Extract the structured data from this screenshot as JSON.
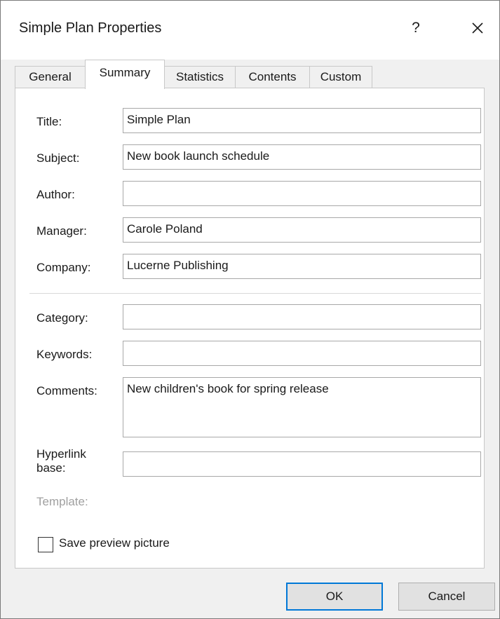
{
  "window": {
    "title": "Simple Plan Properties",
    "help_label": "?"
  },
  "tabs": [
    {
      "label": "General",
      "active": false
    },
    {
      "label": "Summary",
      "active": true
    },
    {
      "label": "Statistics",
      "active": false
    },
    {
      "label": "Contents",
      "active": false
    },
    {
      "label": "Custom",
      "active": false
    }
  ],
  "fields": {
    "title": {
      "label": "Title:",
      "value": "Simple Plan"
    },
    "subject": {
      "label": "Subject:",
      "value": "New book launch schedule"
    },
    "author": {
      "label": "Author:",
      "value": ""
    },
    "manager": {
      "label": "Manager:",
      "value": "Carole Poland"
    },
    "company": {
      "label": "Company:",
      "value": "Lucerne Publishing"
    },
    "category": {
      "label": "Category:",
      "value": ""
    },
    "keywords": {
      "label": "Keywords:",
      "value": ""
    },
    "comments": {
      "label": "Comments:",
      "value": "New children's book for spring release"
    },
    "hyperlink_base": {
      "label_line1": "Hyperlink",
      "label_line2": "base:",
      "value": ""
    },
    "template": {
      "label": "Template:"
    }
  },
  "save_preview": {
    "label": "Save preview picture",
    "checked": false
  },
  "buttons": {
    "ok": "OK",
    "cancel": "Cancel"
  },
  "colors": {
    "accent": "#0078d7",
    "dialog_bg": "#f0f0f0",
    "disabled_text": "#a0a0a0"
  }
}
